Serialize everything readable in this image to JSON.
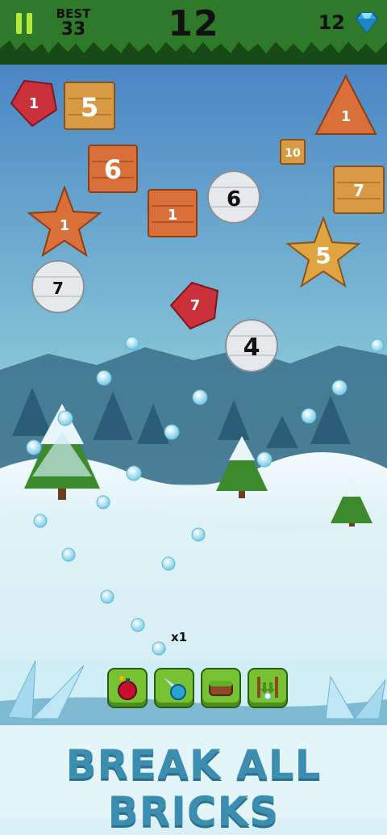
{
  "hud": {
    "best_label": "BEST",
    "best_value": "33",
    "score": "12",
    "gems": "12"
  },
  "icons": {
    "pause": "pause-icon",
    "gem": "diamond-icon"
  },
  "bricks": [
    {
      "shape": "pentagon",
      "color": "red",
      "value": "1"
    },
    {
      "shape": "square",
      "color": "orange-wood",
      "value": "5"
    },
    {
      "shape": "triangle",
      "color": "orange",
      "value": "1"
    },
    {
      "shape": "square",
      "color": "orange-wood",
      "value": "6"
    },
    {
      "shape": "square",
      "color": "orange-wood",
      "value": "10"
    },
    {
      "shape": "square",
      "color": "orange-wood",
      "value": "7"
    },
    {
      "shape": "circle",
      "color": "white",
      "value": "6"
    },
    {
      "shape": "square",
      "color": "orange",
      "value": "1"
    },
    {
      "shape": "star",
      "color": "orange",
      "value": "1"
    },
    {
      "shape": "star",
      "color": "gold",
      "value": "5"
    },
    {
      "shape": "circle",
      "color": "white",
      "value": "7"
    },
    {
      "shape": "pentagon",
      "color": "red",
      "value": "7"
    },
    {
      "shape": "circle",
      "color": "white",
      "value": "4"
    }
  ],
  "ball_multiplier": "x1",
  "powerups": [
    {
      "name": "bomb",
      "icon": "bomb-icon"
    },
    {
      "name": "fireball",
      "icon": "comet-icon"
    },
    {
      "name": "floor",
      "icon": "platform-icon"
    },
    {
      "name": "recall",
      "icon": "recall-arrows-icon"
    }
  ],
  "banner": "BREAK ALL BRICKS",
  "colors": {
    "topbar": "#2f7a2a",
    "sky_top": "#4a86c4",
    "sky_bottom": "#d7eef0",
    "brick_red": "#c9303a",
    "brick_orange": "#d9703a",
    "brick_gold": "#e0a440",
    "banner": "#3b8eb0"
  }
}
